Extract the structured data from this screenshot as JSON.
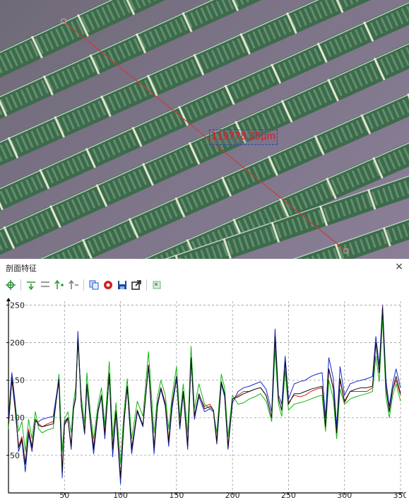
{
  "measurement": {
    "label": "119778.35μm",
    "line_color": "#c83c3c",
    "label_color": "#e01818"
  },
  "panel": {
    "title": "剖面特征",
    "close_glyph": "×",
    "toolbar": [
      {
        "icon": "crosshair-icon",
        "color": "#1a8a2a"
      },
      {
        "icon": "add-point-down-icon",
        "color": "#2a9a2a"
      },
      {
        "icon": "remove-point-down-icon",
        "color": "#7a7a7a"
      },
      {
        "icon": "add-point-up-icon",
        "color": "#2a9a2a"
      },
      {
        "icon": "remove-point-up-icon",
        "color": "#7a7a7a"
      },
      {
        "icon": "copy-icon",
        "color": "#2a5ac8"
      },
      {
        "icon": "record-icon",
        "color": "#d02020"
      },
      {
        "icon": "save-icon",
        "color": "#1a4aa8"
      },
      {
        "icon": "export-icon",
        "color": "#222222"
      },
      {
        "icon": "settings-icon",
        "color": "#7ab07a"
      }
    ]
  },
  "chart_data": {
    "type": "line",
    "title": "",
    "xlabel": "",
    "ylabel": "",
    "xlim": [
      0,
      350
    ],
    "ylim": [
      0,
      255
    ],
    "x_ticks": [
      50,
      100,
      150,
      200,
      250,
      300,
      350
    ],
    "y_ticks": [
      50,
      100,
      150,
      200,
      250
    ],
    "grid": true,
    "x": [
      0,
      3,
      6,
      9,
      12,
      15,
      18,
      21,
      24,
      27,
      30,
      35,
      40,
      45,
      48,
      50,
      53,
      56,
      58,
      60,
      62,
      65,
      68,
      70,
      73,
      76,
      80,
      83,
      86,
      90,
      93,
      96,
      100,
      103,
      106,
      110,
      115,
      120,
      125,
      130,
      133,
      136,
      140,
      143,
      146,
      150,
      153,
      156,
      160,
      163,
      166,
      170,
      175,
      180,
      183,
      186,
      190,
      193,
      196,
      200,
      205,
      210,
      215,
      220,
      225,
      230,
      235,
      238,
      241,
      244,
      247,
      250,
      255,
      260,
      265,
      270,
      275,
      280,
      283,
      286,
      290,
      293,
      296,
      300,
      305,
      310,
      315,
      320,
      325,
      328,
      331,
      334,
      337,
      340,
      343,
      346,
      350
    ],
    "series": [
      {
        "color": "#e01a1a",
        "values": [
          95,
          150,
          110,
          62,
          75,
          40,
          85,
          62,
          98,
          92,
          88,
          92,
          95,
          150,
          30,
          90,
          98,
          65,
          110,
          128,
          210,
          118,
          82,
          145,
          98,
          62,
          110,
          130,
          80,
          160,
          60,
          110,
          18,
          95,
          140,
          60,
          110,
          90,
          170,
          60,
          118,
          140,
          120,
          70,
          118,
          155,
          90,
          135,
          65,
          180,
          102,
          130,
          115,
          118,
          110,
          70,
          145,
          130,
          62,
          125,
          130,
          135,
          135,
          138,
          140,
          130,
          100,
          205,
          125,
          110,
          175,
          120,
          130,
          128,
          130,
          135,
          138,
          140,
          90,
          165,
          140,
          80,
          150,
          120,
          135,
          135,
          135,
          135,
          140,
          200,
          160,
          250,
          140,
          110,
          138,
          150,
          130
        ]
      },
      {
        "color": "#14b414",
        "values": [
          85,
          155,
          118,
          82,
          95,
          55,
          98,
          72,
          108,
          85,
          80,
          84,
          86,
          158,
          55,
          98,
          108,
          80,
          120,
          140,
          200,
          128,
          92,
          160,
          108,
          72,
          118,
          140,
          90,
          175,
          75,
          120,
          40,
          105,
          152,
          72,
          122,
          102,
          188,
          80,
          128,
          150,
          130,
          85,
          128,
          168,
          100,
          145,
          80,
          195,
          112,
          145,
          118,
          112,
          108,
          80,
          158,
          140,
          75,
          130,
          118,
          120,
          125,
          128,
          132,
          122,
          95,
          190,
          118,
          102,
          162,
          110,
          118,
          120,
          122,
          125,
          128,
          130,
          82,
          150,
          125,
          72,
          138,
          118,
          125,
          128,
          130,
          132,
          135,
          182,
          148,
          232,
          128,
          100,
          130,
          145,
          122
        ]
      },
      {
        "color": "#1428c8",
        "values": [
          100,
          160,
          120,
          55,
          70,
          28,
          78,
          55,
          95,
          95,
          98,
          100,
          102,
          152,
          20,
          95,
          100,
          58,
          112,
          125,
          215,
          115,
          78,
          142,
          95,
          52,
          108,
          128,
          72,
          158,
          48,
          105,
          12,
          90,
          142,
          52,
          108,
          88,
          168,
          52,
          115,
          138,
          115,
          62,
          112,
          152,
          85,
          132,
          58,
          178,
          98,
          128,
          108,
          112,
          108,
          65,
          145,
          128,
          58,
          120,
          135,
          140,
          142,
          145,
          148,
          138,
          108,
          218,
          130,
          118,
          182,
          125,
          145,
          148,
          150,
          155,
          158,
          160,
          100,
          180,
          152,
          88,
          168,
          130,
          145,
          148,
          150,
          152,
          155,
          208,
          170,
          248,
          150,
          115,
          145,
          165,
          140
        ]
      },
      {
        "color": "#111111",
        "values": [
          92,
          152,
          112,
          60,
          72,
          38,
          82,
          60,
          98,
          90,
          88,
          90,
          92,
          150,
          28,
          92,
          100,
          62,
          112,
          128,
          205,
          118,
          80,
          145,
          98,
          58,
          110,
          130,
          78,
          158,
          58,
          108,
          20,
          92,
          142,
          58,
          110,
          90,
          170,
          60,
          118,
          140,
          118,
          68,
          118,
          155,
          88,
          135,
          62,
          180,
          102,
          132,
          112,
          115,
          110,
          68,
          148,
          132,
          60,
          125,
          128,
          132,
          135,
          138,
          140,
          130,
          100,
          208,
          125,
          110,
          175,
          118,
          132,
          132,
          135,
          138,
          140,
          142,
          88,
          165,
          138,
          80,
          152,
          122,
          135,
          138,
          140,
          140,
          142,
          200,
          160,
          245,
          140,
          108,
          138,
          155,
          132
        ]
      }
    ]
  }
}
